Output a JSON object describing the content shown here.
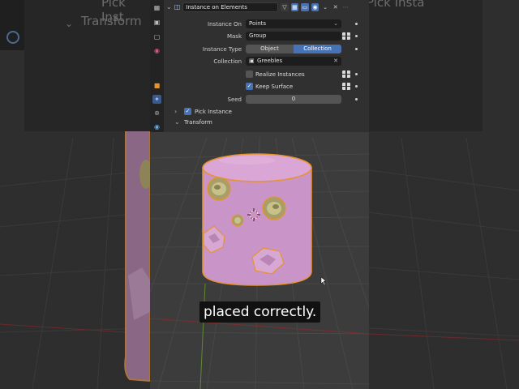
{
  "background_left": {
    "label_1": "Pick Inst",
    "label_2": "Transform"
  },
  "background_right": {
    "label": "Pick Insta"
  },
  "node": {
    "name": "Instance on Elements",
    "instance_on": {
      "label": "Instance On",
      "value": "Points"
    },
    "mask": {
      "label": "Mask",
      "value": "Group"
    },
    "instance_type": {
      "label": "Instance Type",
      "options": [
        "Object",
        "Collection"
      ],
      "selected": "Collection"
    },
    "collection": {
      "label": "Collection",
      "value": "Greebles"
    },
    "realize_instances": {
      "label": "Realize Instances",
      "checked": false
    },
    "keep_surface": {
      "label": "Keep Surface",
      "checked": true
    },
    "seed": {
      "label": "Seed",
      "value": "0"
    },
    "pick_instance": {
      "label": "Pick Instance",
      "checked": true
    },
    "transform": {
      "label": "Transform"
    }
  },
  "colors": {
    "accent_blue": "#4772b3",
    "object_pink": "#c994c7",
    "selection_orange": "#e8932c",
    "panel_bg": "#303030"
  },
  "caption": "placed correctly."
}
